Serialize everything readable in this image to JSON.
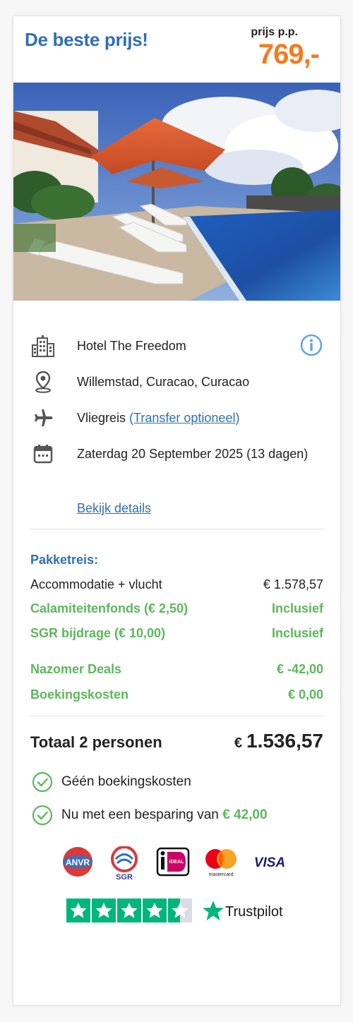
{
  "header": {
    "title": "De beste prijs!",
    "price_label": "prijs p.p.",
    "price_value": "769,-"
  },
  "colors": {
    "brand_blue": "#2f6fb7",
    "accent_orange": "#f47b20",
    "success_green": "#5cb85c",
    "trustpilot_green": "#00b67a"
  },
  "hotel": {
    "name": "Hotel The Freedom",
    "location": "Willemstad, Curacao, Curacao",
    "travel_type": "Vliegreis",
    "transfer_link": "(Transfer optioneel)",
    "date": "Zaterdag 20 September 2025 (13 dagen)",
    "details_link": "Bekijk details"
  },
  "package": {
    "heading": "Pakketreis:",
    "lines": [
      {
        "label": "Accommodatie + vlucht",
        "value": "€ 1.578,57"
      },
      {
        "label": "Calamiteitenfonds (€ 2,50)",
        "value": "Inclusief"
      },
      {
        "label": "SGR bijdrage (€ 10,00)",
        "value": "Inclusief"
      },
      {
        "label": "Nazomer Deals",
        "value": "€ -42,00"
      },
      {
        "label": "Boekingskosten",
        "value": "€ 0,00"
      }
    ]
  },
  "total": {
    "label": "Totaal 2 personen",
    "currency": "€",
    "value": "1.536,57"
  },
  "benefits": [
    {
      "text": "Géén boekingskosten"
    },
    {
      "text": "Nu met een besparing van",
      "highlight": "€ 42,00"
    }
  ],
  "payment_logos": {
    "anvr": "ANVR",
    "sgr": "SGR",
    "ideal": "iDEAL",
    "mastercard": "mastercard",
    "visa": "VISA"
  },
  "trustpilot": {
    "rating_stars": 4.5,
    "label": "Trustpilot"
  }
}
